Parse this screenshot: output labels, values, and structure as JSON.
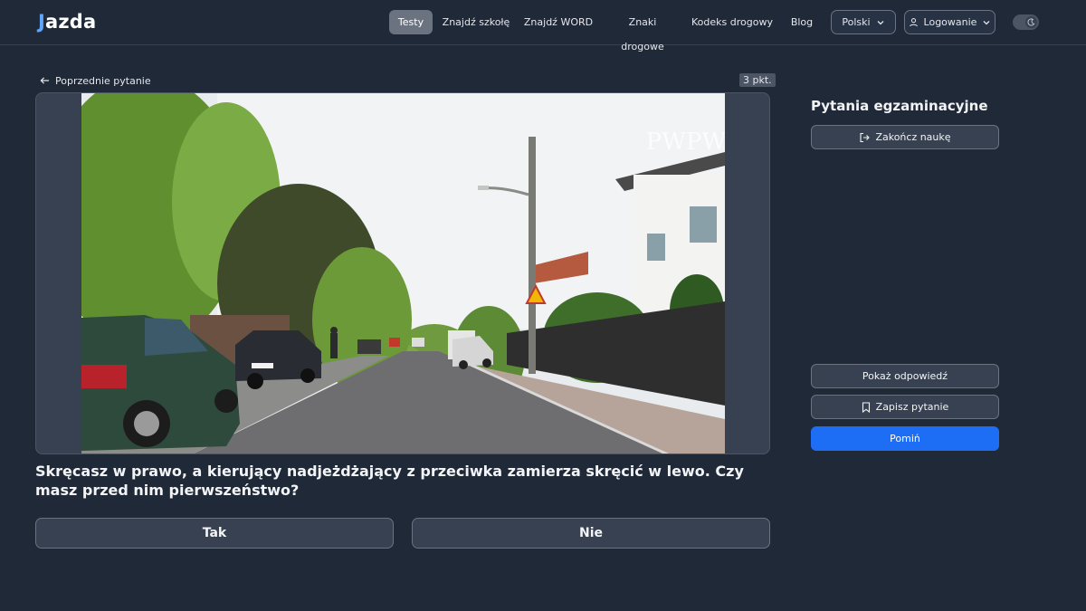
{
  "brand": {
    "logo_j": "J",
    "logo_rest": "azda"
  },
  "nav": {
    "items": [
      {
        "label": "Testy",
        "active": true
      },
      {
        "label": "Znajdź szkołę"
      },
      {
        "label": "Znajdź WORD"
      },
      {
        "label": "Znaki drogowe"
      },
      {
        "label": "Kodeks drogowy"
      },
      {
        "label": "Blog"
      }
    ],
    "language": "Polski",
    "login": "Logowanie"
  },
  "question_nav": {
    "back_label": "Poprzednie pytanie",
    "points": "3 pkt."
  },
  "media": {
    "watermark": "PWPW"
  },
  "question": {
    "text": "Skręcasz w prawo, a kierujący nadjeżdżający z przeciwka zamierza skręcić w lewo. Czy masz przed nim pierwszeństwo?",
    "answers": [
      "Tak",
      "Nie"
    ]
  },
  "sidebar": {
    "title": "Pytania egzaminacyjne",
    "end_label": "Zakończ naukę",
    "show_answer_label": "Pokaż odpowiedź",
    "save_label": "Zapisz pytanie",
    "skip_label": "Pomiń"
  },
  "colors": {
    "background": "#1f2937",
    "accent": "#1d6ef5",
    "panel": "#374151"
  }
}
